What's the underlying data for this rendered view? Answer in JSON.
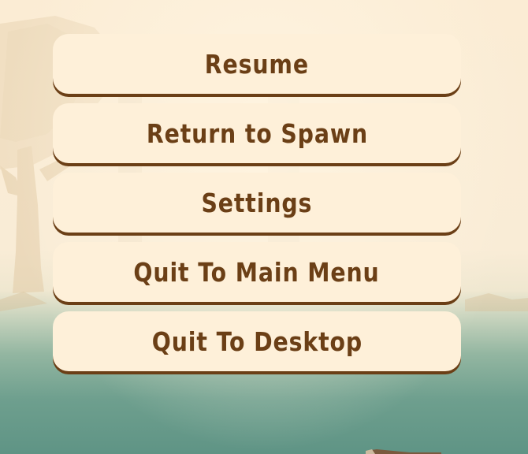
{
  "pause_menu": {
    "buttons": [
      {
        "label": "Resume"
      },
      {
        "label": "Return to Spawn"
      },
      {
        "label": "Settings"
      },
      {
        "label": "Quit To Main Menu"
      },
      {
        "label": "Quit To Desktop"
      }
    ]
  },
  "colors": {
    "button_fill": "#fef0d9",
    "button_text": "#6b3f16",
    "sky": "#fbecd4",
    "water": "#5f9485"
  }
}
